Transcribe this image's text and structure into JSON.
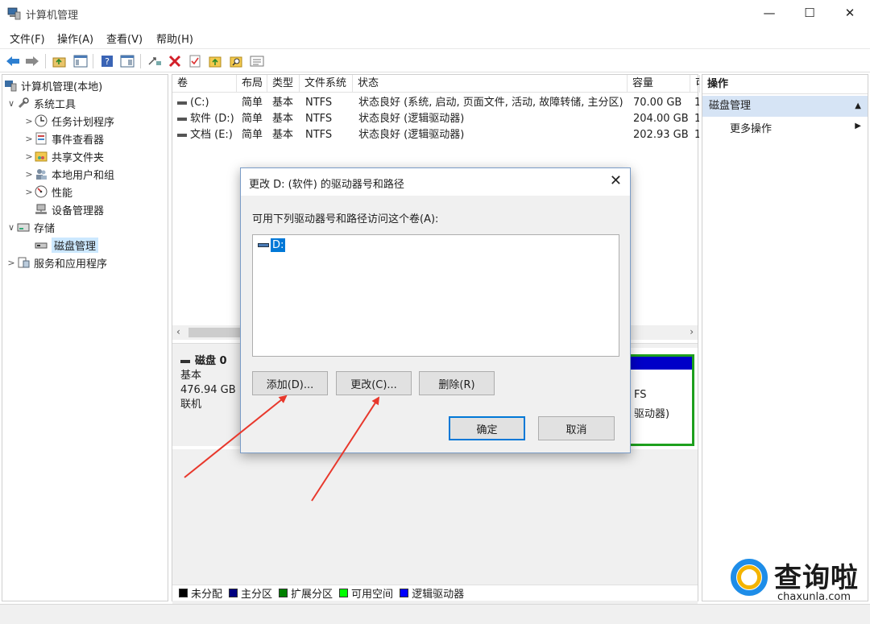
{
  "window": {
    "title": "计算机管理",
    "controls": {
      "minimize": "—",
      "maximize": "☐",
      "close": "✕"
    }
  },
  "menu": [
    "文件(F)",
    "操作(A)",
    "查看(V)",
    "帮助(H)"
  ],
  "toolbar": {
    "icons": [
      "back-arrow-icon",
      "forward-arrow-icon",
      "up-folder-icon",
      "console-tree-icon",
      "help-icon",
      "properties-pane-icon",
      "connect-icon",
      "delete-icon",
      "check-icon",
      "folder-up-icon",
      "search-folder-icon",
      "details-icon"
    ]
  },
  "tree": {
    "root": "计算机管理(本地)",
    "items": [
      {
        "label": "系统工具",
        "chevron": "∨",
        "level": 1
      },
      {
        "label": "任务计划程序",
        "chevron": ">",
        "level": 2
      },
      {
        "label": "事件查看器",
        "chevron": ">",
        "level": 2
      },
      {
        "label": "共享文件夹",
        "chevron": ">",
        "level": 2
      },
      {
        "label": "本地用户和组",
        "chevron": ">",
        "level": 2
      },
      {
        "label": "性能",
        "chevron": ">",
        "level": 2
      },
      {
        "label": "设备管理器",
        "chevron": "",
        "level": 2
      },
      {
        "label": "存储",
        "chevron": "∨",
        "level": 1
      },
      {
        "label": "磁盘管理",
        "chevron": "",
        "level": 2,
        "selected": true
      },
      {
        "label": "服务和应用程序",
        "chevron": ">",
        "level": 1
      }
    ]
  },
  "volumes": {
    "columns": [
      "卷",
      "布局",
      "类型",
      "文件系统",
      "状态",
      "容量",
      "可"
    ],
    "rows": [
      {
        "vol": "(C:)",
        "layout": "简单",
        "type": "基本",
        "fs": "NTFS",
        "status": "状态良好 (系统, 启动, 页面文件, 活动, 故障转储, 主分区)",
        "cap": "70.00 GB",
        "free": "1"
      },
      {
        "vol": "软件 (D:)",
        "layout": "简单",
        "type": "基本",
        "fs": "NTFS",
        "status": "状态良好 (逻辑驱动器)",
        "cap": "204.00 GB",
        "free": "1"
      },
      {
        "vol": "文档 (E:)",
        "layout": "简单",
        "type": "基本",
        "fs": "NTFS",
        "status": "状态良好 (逻辑驱动器)",
        "cap": "202.93 GB",
        "free": "1"
      }
    ]
  },
  "disk": {
    "name": "磁盘 0",
    "type": "基本",
    "size": "476.94 GB",
    "status": "联机",
    "partition_fs": "FS",
    "partition_status": "驱动器)"
  },
  "legend": [
    {
      "label": "未分配",
      "color": "#000000"
    },
    {
      "label": "主分区",
      "color": "#000080"
    },
    {
      "label": "扩展分区",
      "color": "#008000"
    },
    {
      "label": "可用空间",
      "color": "#00ff00"
    },
    {
      "label": "逻辑驱动器",
      "color": "#0000ff"
    }
  ],
  "actions": {
    "header": "操作",
    "section": "磁盘管理",
    "more": "更多操作"
  },
  "dialog": {
    "title": "更改 D: (软件) 的驱动器号和路径",
    "label": "可用下列驱动器号和路径访问这个卷(A):",
    "list_item": "D:",
    "buttons": {
      "add": "添加(D)...",
      "change": "更改(C)...",
      "remove": "删除(R)",
      "ok": "确定",
      "cancel": "取消"
    }
  },
  "watermark": {
    "brand": "查询啦",
    "url": "chaxunla.com"
  }
}
